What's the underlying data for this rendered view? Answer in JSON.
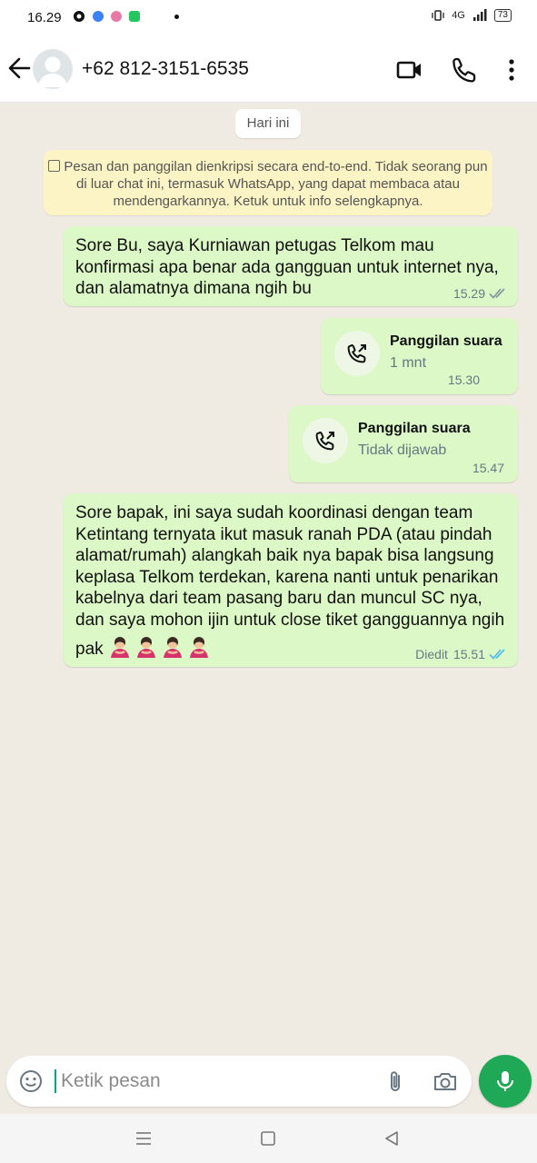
{
  "status_bar": {
    "time": "16.29",
    "network": "4G",
    "battery": "73"
  },
  "header": {
    "contact_name": "+62 812-3151-6535"
  },
  "chat": {
    "date_label": "Hari ini",
    "encryption_notice": "Pesan dan panggilan dienkripsi secara end-to-end. Tidak seorang pun di luar chat ini, termasuk WhatsApp, yang dapat membaca atau mendengarkannya. Ketuk untuk info selengkapnya.",
    "messages": [
      {
        "type": "text",
        "text": "Sore Bu, saya Kurniawan petugas Telkom mau konfirmasi apa benar ada gangguan untuk internet nya, dan alamatnya dimana ngih bu",
        "time": "15.29",
        "status": "delivered"
      },
      {
        "type": "call",
        "title": "Panggilan suara",
        "subtitle": "1 mnt",
        "time": "15.30"
      },
      {
        "type": "call",
        "title": "Panggilan suara",
        "subtitle": "Tidak dijawab",
        "time": "15.47"
      },
      {
        "type": "text",
        "text": "Sore bapak, ini saya sudah koordinasi dengan team Ketintang ternyata ikut masuk ranah PDA (atau pindah alamat/rumah) alangkah baik nya bapak bisa langsung keplasa Telkom terdekan, karena nanti untuk penarikan kabelnya dari team pasang baru dan muncul SC nya, dan saya mohon ijin untuk close tiket gangguannya ngih pak",
        "edited_label": "Diedit",
        "time": "15.51",
        "status": "read",
        "emoji": "person-bowing-emoji",
        "emoji_count": 4
      }
    ]
  },
  "input": {
    "placeholder": "Ketik pesan"
  },
  "colors": {
    "bubble_out": "#dcf8c6",
    "background": "#efeae2",
    "accent": "#1fa855",
    "read_ticks": "#53bdeb"
  },
  "icons": [
    "back-arrow-icon",
    "avatar-icon",
    "video-call-icon",
    "phone-icon",
    "more-options-icon",
    "lock-icon",
    "outgoing-call-icon",
    "double-tick-icon",
    "emoji-icon",
    "attach-icon",
    "camera-icon",
    "mic-icon",
    "nav-menu-icon",
    "nav-home-icon",
    "nav-back-icon"
  ]
}
